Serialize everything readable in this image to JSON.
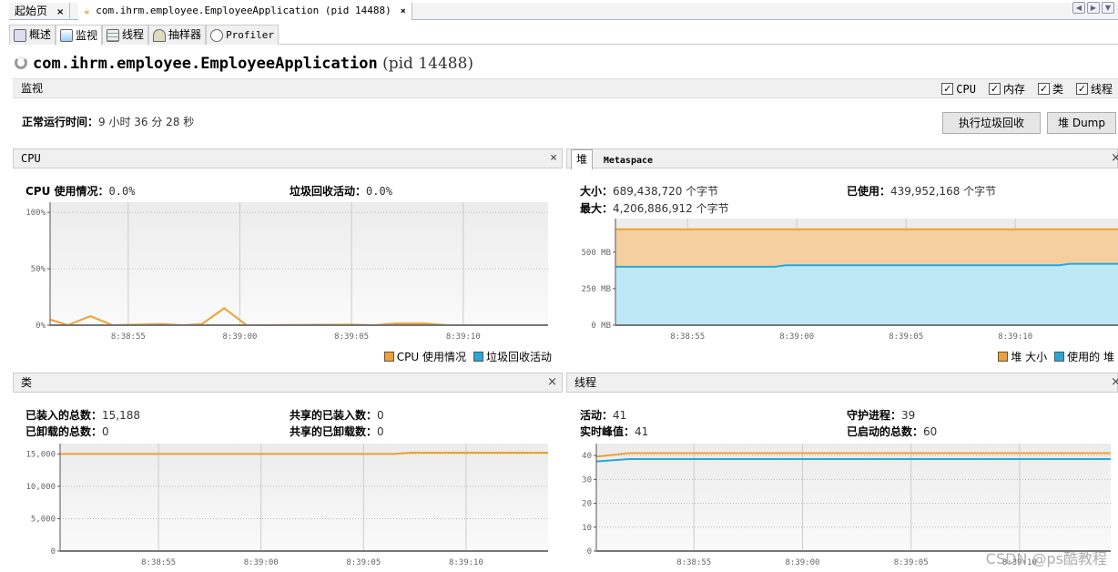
{
  "doc_tabs": [
    {
      "label": "起始页",
      "close": "×"
    },
    {
      "label": "com.ihrm.employee.EmployeeApplication (pid 14488)",
      "close": "×"
    }
  ],
  "sub_tabs": [
    {
      "label": "概述",
      "icon": "info-icon"
    },
    {
      "label": "监视",
      "icon": "monitor-icon",
      "active": true
    },
    {
      "label": "线程",
      "icon": "threads-icon"
    },
    {
      "label": "抽样器",
      "icon": "sampler-icon"
    },
    {
      "label": "Profiler",
      "icon": "profiler-clock-icon"
    }
  ],
  "header": {
    "app": "com.ihrm.employee.EmployeeApplication",
    "pid": "(pid 14488)"
  },
  "monitor": {
    "label": "监视",
    "checks": [
      {
        "label": "CPU",
        "checked": true
      },
      {
        "label": "内存",
        "checked": true
      },
      {
        "label": "类",
        "checked": true
      },
      {
        "label": "线程",
        "checked": true
      }
    ]
  },
  "uptime": {
    "label": "正常运行时间：",
    "value": "9 小时 36 分 28 秒"
  },
  "buttons": {
    "gc": "执行垃圾回收",
    "heap_dump": "堆 Dump"
  },
  "colors": {
    "orange": "#f0a030",
    "blue": "#29a8d8"
  },
  "cpu_panel": {
    "title": "CPU",
    "close": "×",
    "usage_label": "CPU 使用情况：",
    "usage": "0.0%",
    "gc_label": "垃圾回收活动：",
    "gc": "0.0%",
    "legend": [
      "CPU 使用情况",
      "垃圾回收活动"
    ]
  },
  "heap_panel": {
    "tabs": [
      "堆",
      "Metaspace"
    ],
    "close": "×",
    "size_label": "大小：",
    "size": "689,438,720 个字节",
    "used_label": "已使用：",
    "used": "439,952,168 个字节",
    "max_label": "最大：",
    "max": "4,206,886,912 个字节",
    "legend": [
      "堆 大小",
      "使用的 堆"
    ]
  },
  "classes_panel": {
    "title": "类",
    "close": "×",
    "loaded_label": "已装入的总数：",
    "loaded": "15,188",
    "unloaded_label": "已卸载的总数：",
    "unloaded": "0",
    "shared_loaded_label": "共享的已装入数：",
    "shared_loaded": "0",
    "shared_unloaded_label": "共享的已卸载数：",
    "shared_unloaded": "0"
  },
  "threads_panel": {
    "title": "线程",
    "close": "×",
    "live_label": "活动：",
    "live": "41",
    "daemon_label": "守护进程：",
    "daemon": "39",
    "peak_label": "实时峰值：",
    "peak": "41",
    "started_label": "已启动的总数：",
    "started": "60"
  },
  "watermark": "CSDN @ps酷教程",
  "chart_data": [
    {
      "id": "cpu",
      "type": "line",
      "xlim": [
        "8:38:51.5",
        "8:39:13.8"
      ],
      "ylim": [
        0,
        109
      ],
      "xticks": [
        "8:38:55",
        "8:39:00",
        "8:39:05",
        "8:39:10"
      ],
      "yticks": [
        {
          "v": 0,
          "label": "0%"
        },
        {
          "v": 50,
          "label": "50%"
        },
        {
          "v": 100,
          "label": "100%"
        }
      ],
      "grid": true,
      "series": [
        {
          "color": "#f0a030",
          "points": [
            [
              "8:38:51.5",
              5
            ],
            [
              "8:38:52.3",
              0
            ],
            [
              "8:38:53.3",
              8
            ],
            [
              "8:38:54.3",
              0
            ],
            [
              "8:38:56.5",
              1
            ],
            [
              "8:38:57.5",
              0
            ],
            [
              "8:38:58.3",
              1
            ],
            [
              "8:38:59.3",
              15
            ],
            [
              "8:39:00.3",
              0
            ],
            [
              "8:39:05",
              0.5
            ],
            [
              "8:39:06",
              0
            ],
            [
              "8:39:07",
              1.5
            ],
            [
              "8:39:08.3",
              1.5
            ],
            [
              "8:39:09.3",
              0
            ],
            [
              "8:39:13.8",
              0
            ]
          ]
        },
        {
          "color": "#29a8d8",
          "points": [
            [
              "8:38:51.5",
              0
            ],
            [
              "8:39:13.8",
              0
            ]
          ]
        }
      ]
    },
    {
      "id": "heap",
      "type": "area",
      "xlim": [
        "8:38:51.7",
        "8:39:14.7"
      ],
      "ylim": [
        0,
        730
      ],
      "xticks": [
        "8:38:55",
        "8:39:00",
        "8:39:05",
        "8:39:10"
      ],
      "yticks": [
        {
          "v": 0,
          "label": "0 MB"
        },
        {
          "v": 250,
          "label": "250 MB"
        },
        {
          "v": 500,
          "label": "500 MB"
        }
      ],
      "grid": true,
      "series": [
        {
          "color": "#f0a030",
          "fill": "#f5cf9f",
          "points": [
            [
              "8:38:51.7",
              657
            ],
            [
              "8:39:14.7",
              657
            ]
          ]
        },
        {
          "color": "#29a8d8",
          "fill": "#bfe8f7",
          "points": [
            [
              "8:38:51.7",
              400
            ],
            [
              "8:38:59",
              400
            ],
            [
              "8:38:59.5",
              410
            ],
            [
              "8:39:12",
              410
            ],
            [
              "8:39:12.5",
              420
            ],
            [
              "8:39:14.7",
              420
            ]
          ]
        }
      ]
    },
    {
      "id": "classes",
      "type": "line",
      "xlim": [
        "8:38:50.2",
        "8:39:14"
      ],
      "ylim": [
        0,
        16600
      ],
      "xticks": [
        "8:38:55",
        "8:39:00",
        "8:39:05",
        "8:39:10"
      ],
      "yticks": [
        {
          "v": 0,
          "label": "0"
        },
        {
          "v": 5000,
          "label": "5,000"
        },
        {
          "v": 10000,
          "label": "10,000"
        },
        {
          "v": 15000,
          "label": "15,000"
        }
      ],
      "grid": true,
      "series": [
        {
          "color": "#f0a030",
          "points": [
            [
              "8:38:50.2",
              15000
            ],
            [
              "8:39:06.5",
              15000
            ],
            [
              "8:39:07.3",
              15188
            ],
            [
              "8:39:14",
              15188
            ]
          ]
        },
        {
          "color": "#29a8d8",
          "points": [
            [
              "8:38:50.2",
              0
            ],
            [
              "8:39:14",
              0
            ]
          ]
        }
      ]
    },
    {
      "id": "threads",
      "type": "line",
      "xlim": [
        "8:38:50.5",
        "8:39:14.2"
      ],
      "ylim": [
        0,
        45
      ],
      "xticks": [
        "8:38:55",
        "8:39:00",
        "8:39:05",
        "8:39:10"
      ],
      "yticks": [
        {
          "v": 0,
          "label": "0"
        },
        {
          "v": 10,
          "label": "10"
        },
        {
          "v": 20,
          "label": "20"
        },
        {
          "v": 30,
          "label": "30"
        },
        {
          "v": 40,
          "label": "40"
        }
      ],
      "grid": true,
      "series": [
        {
          "color": "#f0a030",
          "points": [
            [
              "8:38:50.5",
              39.5
            ],
            [
              "8:38:52",
              41
            ],
            [
              "8:39:14.2",
              41
            ]
          ]
        },
        {
          "color": "#29a8d8",
          "points": [
            [
              "8:38:50.5",
              37.5
            ],
            [
              "8:38:52",
              38.5
            ],
            [
              "8:39:14.2",
              38.5
            ]
          ]
        }
      ]
    }
  ]
}
